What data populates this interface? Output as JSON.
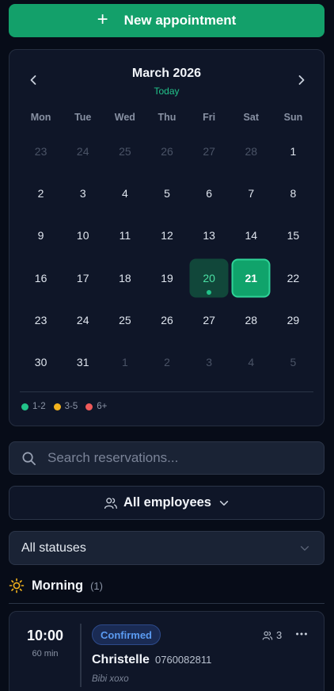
{
  "new_appointment": {
    "plus": "+",
    "label": "New appointment"
  },
  "calendar": {
    "month_label": "March 2026",
    "today_label": "Today",
    "prev_icon": "chevron-left-icon",
    "next_icon": "chevron-right-icon",
    "weekdays": [
      "Mon",
      "Tue",
      "Wed",
      "Thu",
      "Fri",
      "Sat",
      "Sun"
    ],
    "days": [
      {
        "n": "23",
        "out": true
      },
      {
        "n": "24",
        "out": true
      },
      {
        "n": "25",
        "out": true
      },
      {
        "n": "26",
        "out": true
      },
      {
        "n": "27",
        "out": true
      },
      {
        "n": "28",
        "out": true
      },
      {
        "n": "1"
      },
      {
        "n": "2"
      },
      {
        "n": "3"
      },
      {
        "n": "4"
      },
      {
        "n": "5"
      },
      {
        "n": "6"
      },
      {
        "n": "7"
      },
      {
        "n": "8"
      },
      {
        "n": "9"
      },
      {
        "n": "10"
      },
      {
        "n": "11"
      },
      {
        "n": "12"
      },
      {
        "n": "13"
      },
      {
        "n": "14"
      },
      {
        "n": "15"
      },
      {
        "n": "16"
      },
      {
        "n": "17"
      },
      {
        "n": "18"
      },
      {
        "n": "19"
      },
      {
        "n": "20",
        "state": "today",
        "dot": "1-2"
      },
      {
        "n": "21",
        "state": "selected"
      },
      {
        "n": "22"
      },
      {
        "n": "23"
      },
      {
        "n": "24"
      },
      {
        "n": "25"
      },
      {
        "n": "26"
      },
      {
        "n": "27"
      },
      {
        "n": "28"
      },
      {
        "n": "29"
      },
      {
        "n": "30"
      },
      {
        "n": "31"
      },
      {
        "n": "1",
        "out": true
      },
      {
        "n": "2",
        "out": true
      },
      {
        "n": "3",
        "out": true
      },
      {
        "n": "4",
        "out": true
      },
      {
        "n": "5",
        "out": true
      }
    ],
    "legend": [
      {
        "label": "1-2",
        "color": "#22c38a"
      },
      {
        "label": "3-5",
        "color": "#f2b21d"
      },
      {
        "label": "6+",
        "color": "#ef5a5a"
      }
    ]
  },
  "search": {
    "placeholder": "Search reservations...",
    "value": ""
  },
  "employee_filter": {
    "label": "All employees",
    "icon": "users-icon"
  },
  "status_filter": {
    "label": "All statuses"
  },
  "section": {
    "icon": "sun-icon",
    "title": "Morning",
    "count": "(1)"
  },
  "appointment": {
    "time": "10:00",
    "duration": "60 min",
    "status": "Confirmed",
    "guests": "3",
    "name": "Christelle",
    "phone": "0760082811",
    "note": "Bibi xoxo"
  },
  "colors": {
    "accent": "#13a06a",
    "background": "#070c18",
    "panel": "#0f1628",
    "confirmed": "#5b9bf2"
  }
}
